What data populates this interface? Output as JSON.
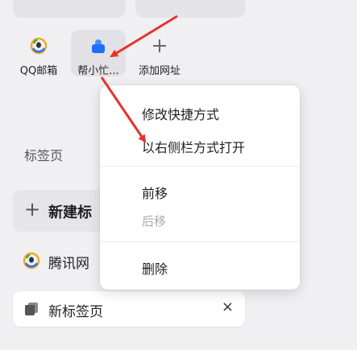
{
  "shortcuts": [
    {
      "label": "QQ邮箱",
      "icon": "qq-mail-icon"
    },
    {
      "label": "帮小忙...",
      "icon": "helper-icon"
    },
    {
      "label": "添加网址",
      "icon": "plus-icon"
    }
  ],
  "sidebar": {
    "section_title": "标签页",
    "new_tab_plus": "+",
    "new_tab_label": "新建标",
    "tabs": [
      {
        "label": "腾讯网",
        "icon": "tencent-icon"
      },
      {
        "label": "新标签页",
        "icon": "tab-stack-icon",
        "close": "×"
      }
    ]
  },
  "context_menu": {
    "edit_shortcut": "修改快捷方式",
    "open_sidebar": "以右侧栏方式打开",
    "move_forward": "前移",
    "move_back": "后移",
    "delete": "删除"
  },
  "colors": {
    "arrow_red": "#e8312e",
    "accent_blue": "#1e6fff"
  }
}
